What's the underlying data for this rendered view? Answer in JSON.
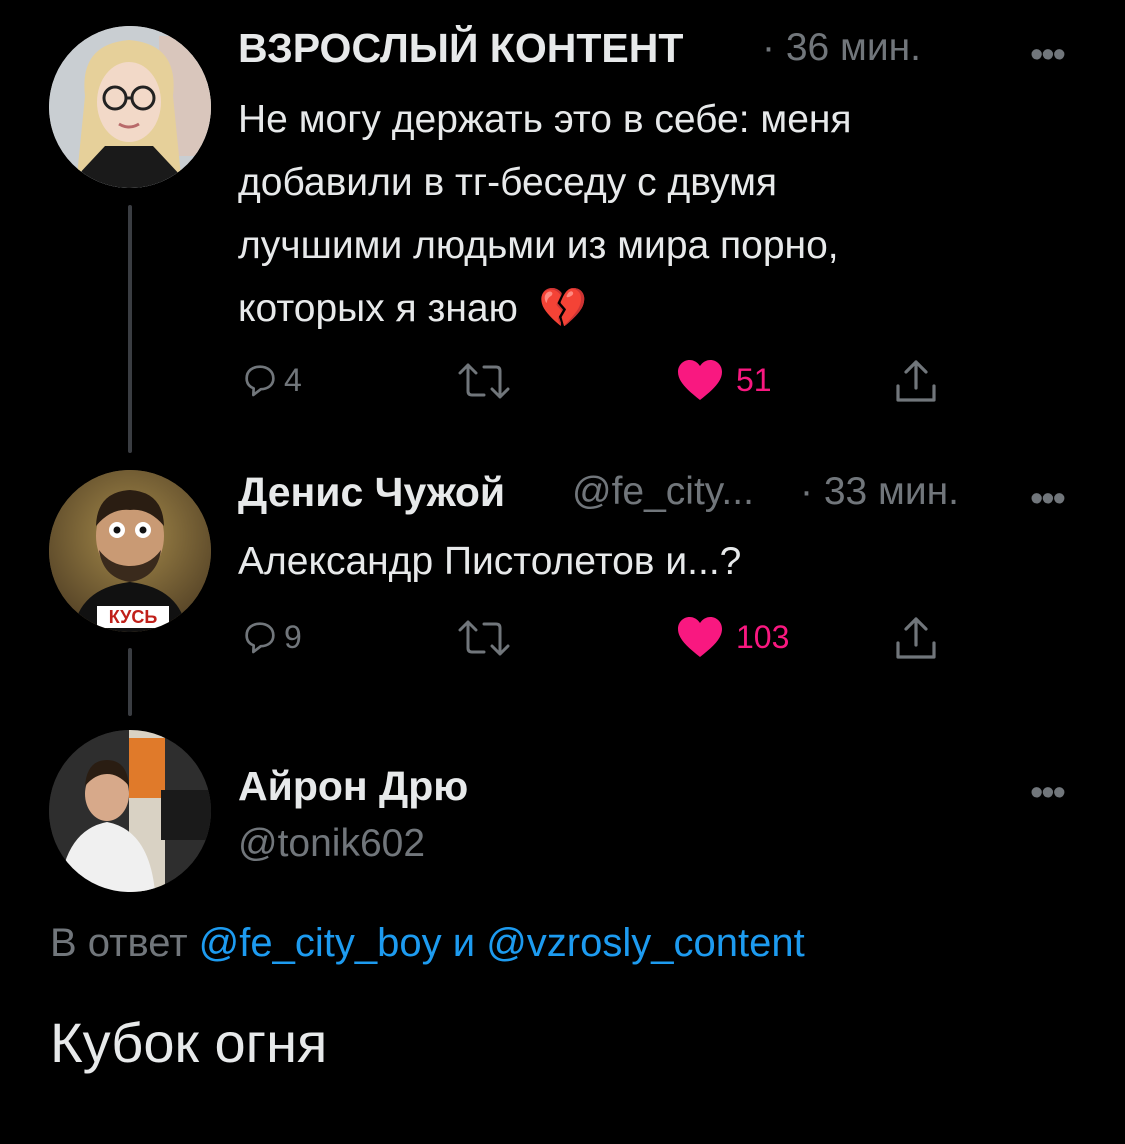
{
  "tweets": [
    {
      "display_name": "ВЗРОСЛЫЙ КОНТЕНТ",
      "time": "· 36 мин.",
      "text_lines": [
        "Не могу держать это в себе: меня",
        "добавили в тг-беседу с двумя",
        "лучшими людьми из мира порно,",
        "которых я знаю"
      ],
      "emoji": "💔",
      "replies": "4",
      "likes": "51",
      "liked": true
    },
    {
      "display_name": "Денис Чужой",
      "handle": "@fe_city...",
      "time": "· 33 мин.",
      "text": "Александр Пистолетов и...?",
      "replies": "9",
      "likes": "103",
      "liked": true,
      "avatar_shirt_text": "КУСЬ"
    }
  ],
  "focused": {
    "display_name": "Айрон Дрю",
    "handle": "@tonik602",
    "reply_prefix": "В ответ",
    "reply_user1": "@fe_city_boy",
    "reply_and": "и",
    "reply_user2": "@vzrosly_content",
    "text": "Кубок огня"
  },
  "more_glyph": "•••",
  "colors": {
    "background": "#000000",
    "text": "#e7e9ea",
    "secondary": "#71767b",
    "like": "#f91880",
    "link": "#1d9bf0"
  },
  "icons": [
    "reply-icon",
    "retweet-icon",
    "heart-icon",
    "share-icon",
    "more-icon"
  ]
}
